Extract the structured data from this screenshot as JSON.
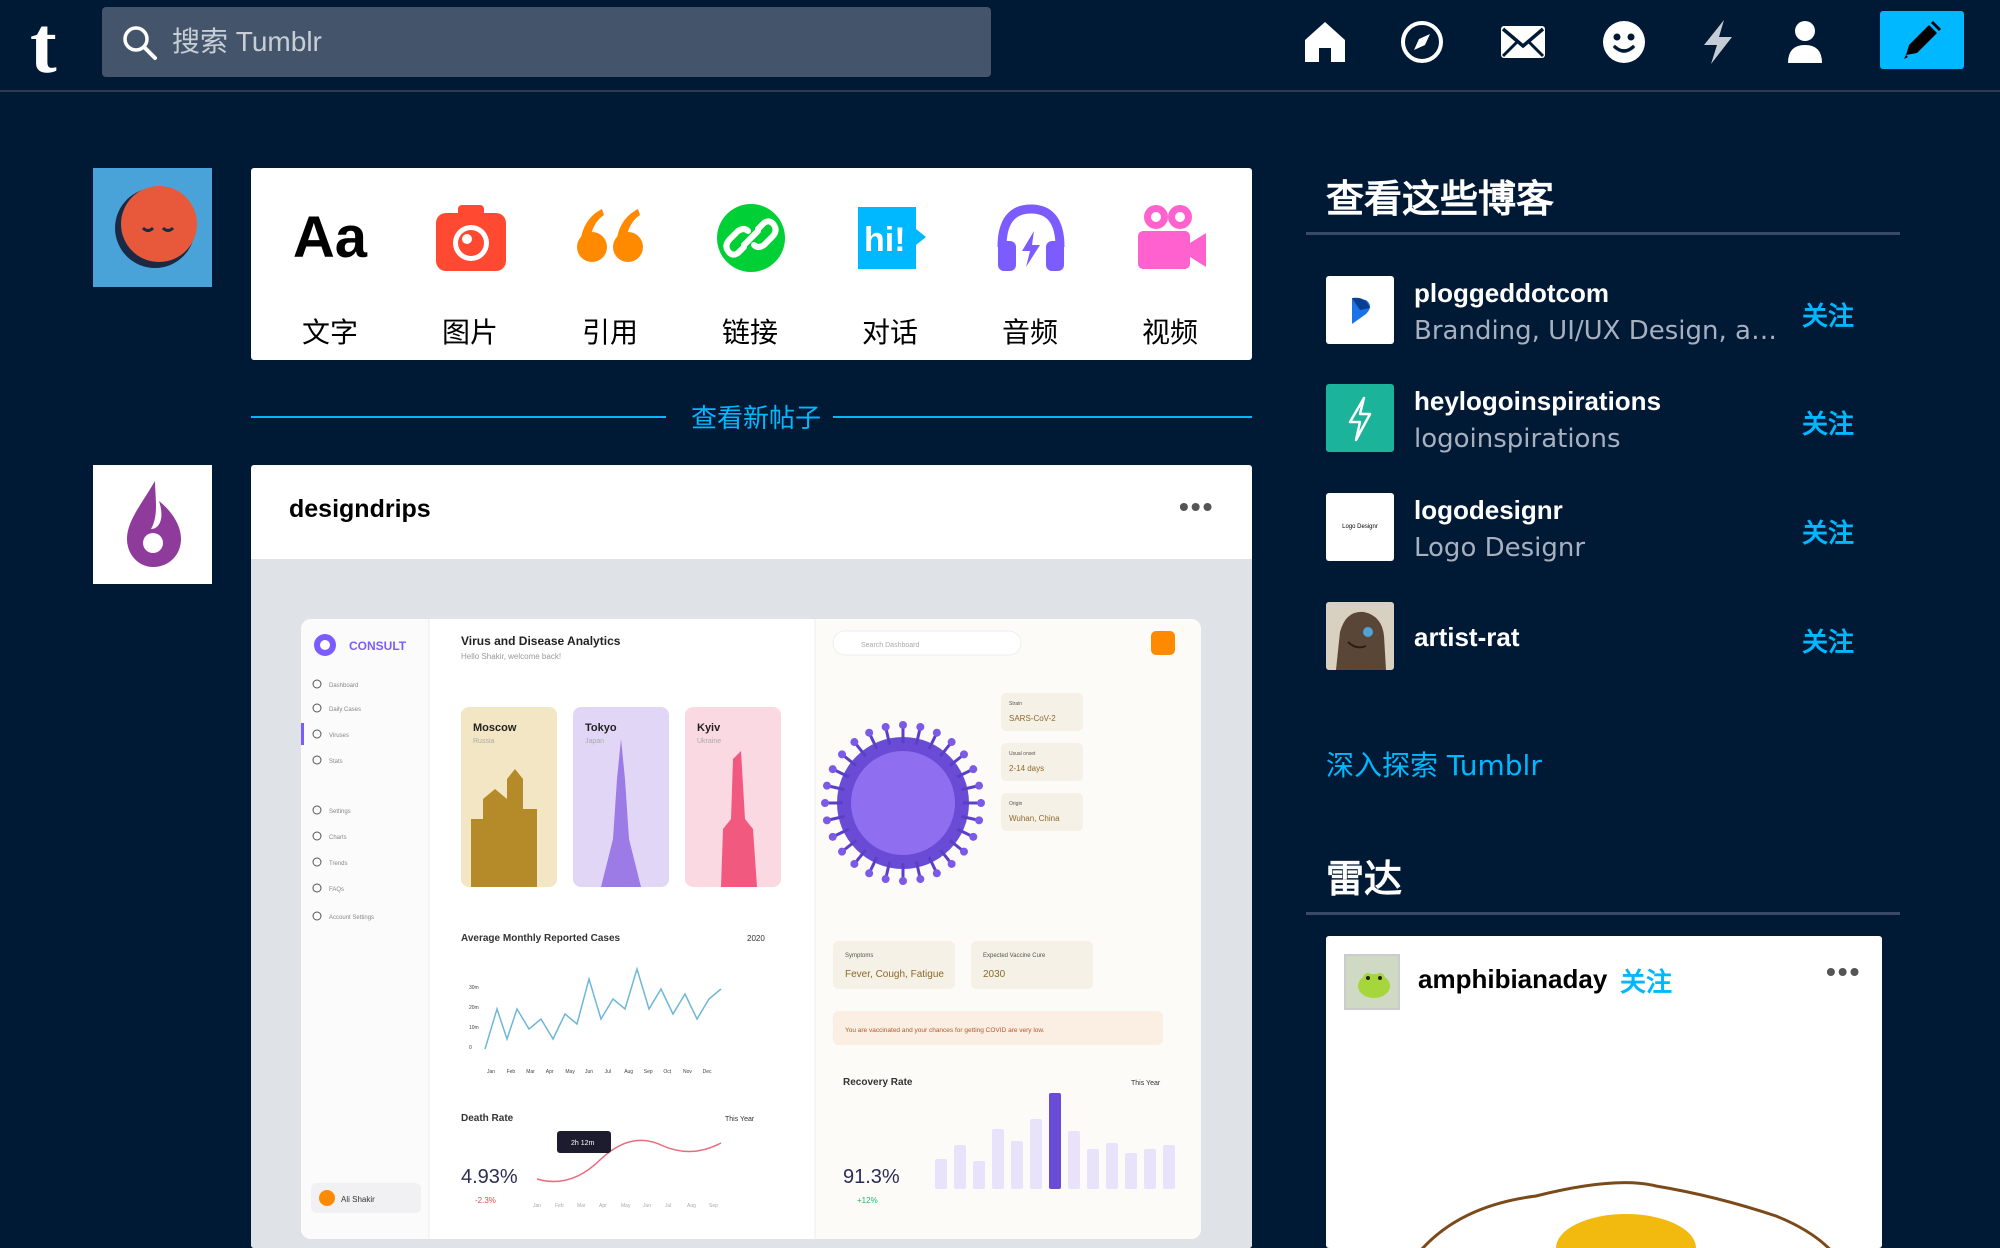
{
  "header": {
    "logo": "t",
    "search_placeholder": "搜索 Tumblr",
    "nav": [
      "home-icon",
      "explore-icon",
      "inbox-icon",
      "messaging-icon",
      "activity-icon",
      "account-icon"
    ],
    "accent": "#00b8ff"
  },
  "post_types": [
    {
      "label": "文字",
      "glyph": "Aa",
      "color": "#000000"
    },
    {
      "label": "图片",
      "color": "#ff4930"
    },
    {
      "label": "引用",
      "glyph": "66",
      "color": "#ff8a00"
    },
    {
      "label": "链接",
      "color": "#00cf35"
    },
    {
      "label": "对话",
      "glyph": "hi!",
      "color": "#00b8ff"
    },
    {
      "label": "音频",
      "color": "#7c5cff"
    },
    {
      "label": "视频",
      "color": "#ff62ce"
    }
  ],
  "feed": {
    "new_posts_label": "查看新帖子",
    "post": {
      "blog_name": "designdrips",
      "more": "•••",
      "dashboard": {
        "brand": "CONSULT",
        "title": "Virus and Disease Analytics",
        "subtitle": "Hello Shakir, welcome back!",
        "search_placeholder": "Search Dashboard",
        "nav": [
          "Dashboard",
          "Daily Cases",
          "Viruses",
          "Stats",
          "Settings",
          "Charts",
          "Trends",
          "FAQs",
          "Account Settings"
        ],
        "cities": [
          {
            "name": "Moscow",
            "country": "Russia"
          },
          {
            "name": "Tokyo",
            "country": "Japan"
          },
          {
            "name": "Kyiv",
            "country": "Ukraine"
          }
        ],
        "info": [
          {
            "label": "Strain",
            "value": "SARS-CoV-2"
          },
          {
            "label": "Usual onset",
            "value": "2-14 days"
          },
          {
            "label": "Origin",
            "value": "Wuhan, China"
          }
        ],
        "symptoms_label": "Symptoms",
        "symptoms": "Fever, Cough, Fatigue",
        "vaccine_label": "Expected Vaccine Cure",
        "vaccine": "2030",
        "notice": "You are vaccinated and your chances for getting COVID are very low.",
        "monthly_title": "Average Monthly Reported Cases",
        "monthly_year": "2020",
        "monthly_yticks": [
          "30m",
          "20m",
          "10m",
          "0"
        ],
        "months": [
          "Jan",
          "Feb",
          "Mar",
          "Apr",
          "May",
          "Jun",
          "Jul",
          "Aug",
          "Sep",
          "Oct",
          "Nov",
          "Dec"
        ],
        "death_title": "Death Rate",
        "death_period": "This Year",
        "death_value": "4.93%",
        "death_change": "-2.3%",
        "death_tooltip": "2h 12m",
        "recovery_title": "Recovery Rate",
        "recovery_period": "This Year",
        "recovery_value": "91.3%",
        "recovery_change": "+12%",
        "user": "Ali Shakir"
      }
    }
  },
  "sidebar": {
    "check_out_title": "查看这些博客",
    "blogs": [
      {
        "name": "ploggeddotcom",
        "desc": "Branding, UI/UX Design, and...",
        "follow": "关注"
      },
      {
        "name": "heylogoinspirations",
        "desc": "logoinspirations",
        "follow": "关注"
      },
      {
        "name": "logodesignr",
        "desc": "Logo Designr",
        "follow": "关注",
        "avatar_text": "Logo Designr"
      },
      {
        "name": "artist-rat",
        "desc": "",
        "follow": "关注"
      }
    ],
    "explore_link": "深入探索 Tumblr",
    "radar_title": "雷达",
    "radar": {
      "name": "amphibianaday",
      "follow": "关注",
      "more": "•••"
    }
  }
}
